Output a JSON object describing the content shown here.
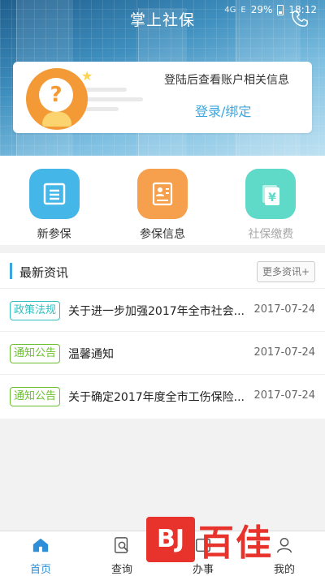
{
  "status_bar": {
    "signal_label": "4G",
    "network_label": "E",
    "battery": "29%",
    "time": "18:12"
  },
  "header": {
    "title": "掌上社保",
    "phone_icon": "phone-icon"
  },
  "login_card": {
    "hint": "登陆后查看账户相关信息",
    "link": "登录/绑定",
    "avatar_icon": "question-avatar-icon"
  },
  "features": [
    {
      "label": "新参保",
      "icon": "document-icon",
      "color": "#45b6e8",
      "enabled": true
    },
    {
      "label": "参保信息",
      "icon": "profile-card-icon",
      "color": "#f6a04d",
      "enabled": true
    },
    {
      "label": "社保缴费",
      "icon": "yuan-payment-icon",
      "color": "#5fd9c8",
      "enabled": false
    }
  ],
  "news": {
    "title": "最新资讯",
    "more": "更多资讯+",
    "items": [
      {
        "tag": "政策法规",
        "tag_type": "policy",
        "text": "关于进一步加强2017年全市社会...",
        "date": "2017-07-24"
      },
      {
        "tag": "通知公告",
        "tag_type": "notice",
        "text": "温馨通知",
        "date": "2017-07-24"
      },
      {
        "tag": "通知公告",
        "tag_type": "notice",
        "text": "关于确定2017年度全市工伤保险...",
        "date": "2017-07-24"
      }
    ]
  },
  "bottom_nav": [
    {
      "label": "首页",
      "icon": "home-icon",
      "active": true
    },
    {
      "label": "查询",
      "icon": "search-doc-icon",
      "active": false
    },
    {
      "label": "办事",
      "icon": "service-icon",
      "active": false
    },
    {
      "label": "我的",
      "icon": "user-icon",
      "active": false
    }
  ],
  "watermark": {
    "logo": "BJ",
    "text": "百佳"
  },
  "colors": {
    "accent": "#3aa6dd",
    "nav_active": "#2e8fd8",
    "policy_tag": "#2fbfbf",
    "notice_tag": "#6abf2e"
  }
}
